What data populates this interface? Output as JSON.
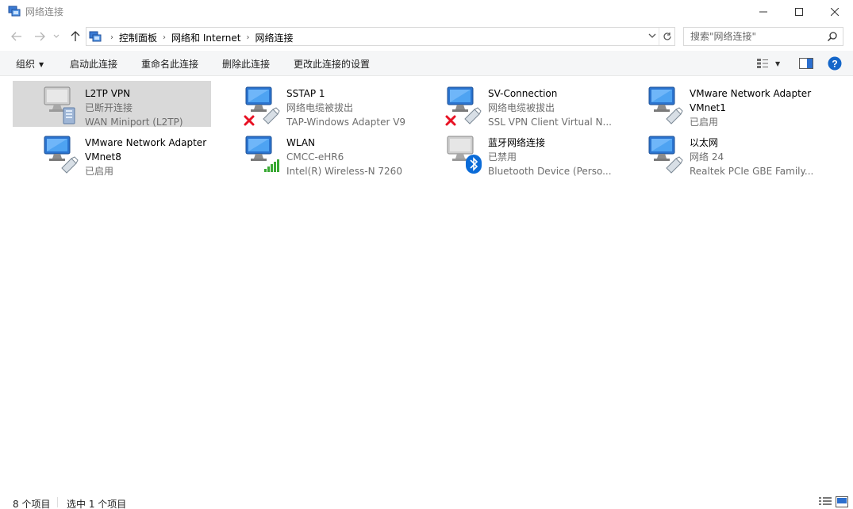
{
  "window": {
    "title": "网络连接"
  },
  "address": {
    "crumbs": [
      "控制面板",
      "网络和 Internet",
      "网络连接"
    ]
  },
  "search": {
    "placeholder": "搜索\"网络连接\""
  },
  "toolbar": {
    "organize": "组织",
    "start": "启动此连接",
    "rename": "重命名此连接",
    "delete": "删除此连接",
    "change_settings": "更改此连接的设置"
  },
  "connections": [
    {
      "name": "L2TP VPN",
      "status": "已断开连接",
      "device": "WAN Miniport (L2TP)",
      "icon": "vpn-network-icon",
      "state": "disconnected-vpn",
      "selected": true
    },
    {
      "name": "SSTAP 1",
      "status": "网络电缆被拔出",
      "device": "TAP-Windows Adapter V9",
      "icon": "network-adapter-icon",
      "state": "cable-unplugged"
    },
    {
      "name": "SV-Connection",
      "status": "网络电缆被拔出",
      "device": "SSL VPN Client Virtual N...",
      "icon": "network-adapter-icon",
      "state": "cable-unplugged"
    },
    {
      "name": "VMware Network Adapter",
      "status": "VMnet1",
      "device": "已启用",
      "icon": "network-adapter-icon",
      "state": "enabled"
    },
    {
      "name": "VMware Network Adapter",
      "status": "VMnet8",
      "device": "已启用",
      "icon": "network-adapter-icon",
      "state": "enabled"
    },
    {
      "name": "WLAN",
      "status": "CMCC-eHR6",
      "device": "Intel(R) Wireless-N 7260",
      "icon": "wifi-signal-icon",
      "state": "wifi"
    },
    {
      "name": "蓝牙网络连接",
      "status": "已禁用",
      "device": "Bluetooth Device (Perso...",
      "icon": "bluetooth-icon",
      "state": "disabled-bluetooth"
    },
    {
      "name": "以太网",
      "status": "网络 24",
      "device": "Realtek PCIe GBE Family...",
      "icon": "network-adapter-icon",
      "state": "enabled"
    }
  ],
  "statusbar": {
    "count": "8 个项目",
    "selected": "选中 1 个项目"
  },
  "colors": {
    "accent": "#0078d7",
    "selected_bg": "#d9d9d9",
    "error_red": "#e81123",
    "wifi_green": "#3aa935",
    "bluetooth_blue": "#0a6bd8"
  }
}
